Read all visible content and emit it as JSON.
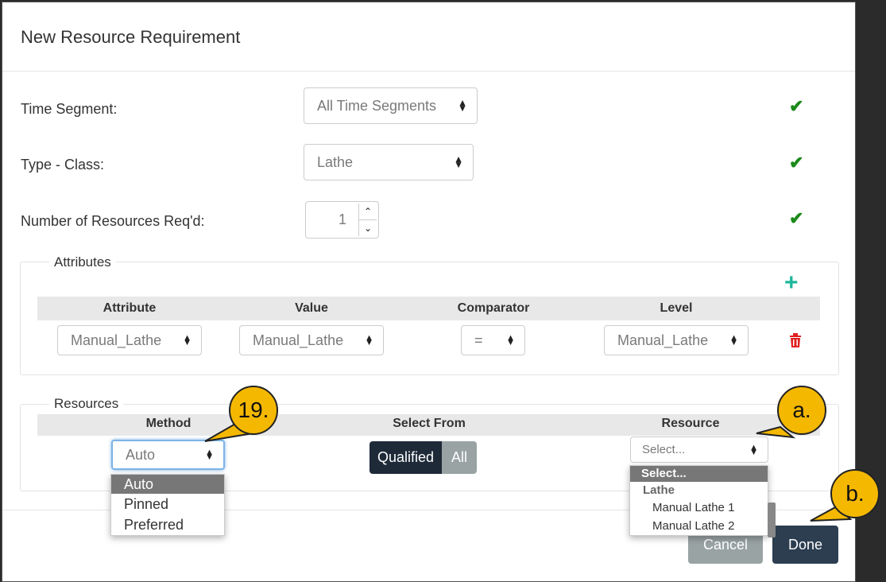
{
  "modal": {
    "title": "New Resource Requirement"
  },
  "form": {
    "time_segment": {
      "label": "Time Segment:",
      "value": "All Time Segments"
    },
    "type_class": {
      "label": "Type - Class:",
      "value": "Lathe"
    },
    "num_resources": {
      "label": "Number of Resources Req'd:",
      "value": "1"
    }
  },
  "attributes": {
    "legend": "Attributes",
    "columns": [
      "Attribute",
      "Value",
      "Comparator",
      "Level"
    ],
    "row": {
      "attribute": "Manual_Lathe",
      "value": "Manual_Lathe",
      "comparator": "=",
      "level": "Manual_Lathe"
    }
  },
  "resources": {
    "legend": "Resources",
    "columns": [
      "Method",
      "Select From",
      "Resource"
    ],
    "method": {
      "value": "Auto",
      "options": [
        "Auto",
        "Pinned",
        "Preferred"
      ]
    },
    "select_from": {
      "qualified": "Qualified",
      "all": "All"
    },
    "resource": {
      "placeholder": "Select...",
      "options_header": "Select...",
      "group": "Lathe",
      "options": [
        "Manual Lathe 1",
        "Manual Lathe 2"
      ]
    }
  },
  "footer": {
    "cancel": "Cancel",
    "done": "Done"
  },
  "callouts": {
    "c19": "19.",
    "ca": "a.",
    "cb": "b."
  },
  "colors": {
    "check": "#1a8a1a",
    "plus": "#1db79a",
    "trash": "#e02020",
    "done_bg": "#2c3e50",
    "callout": "#f5b800"
  }
}
